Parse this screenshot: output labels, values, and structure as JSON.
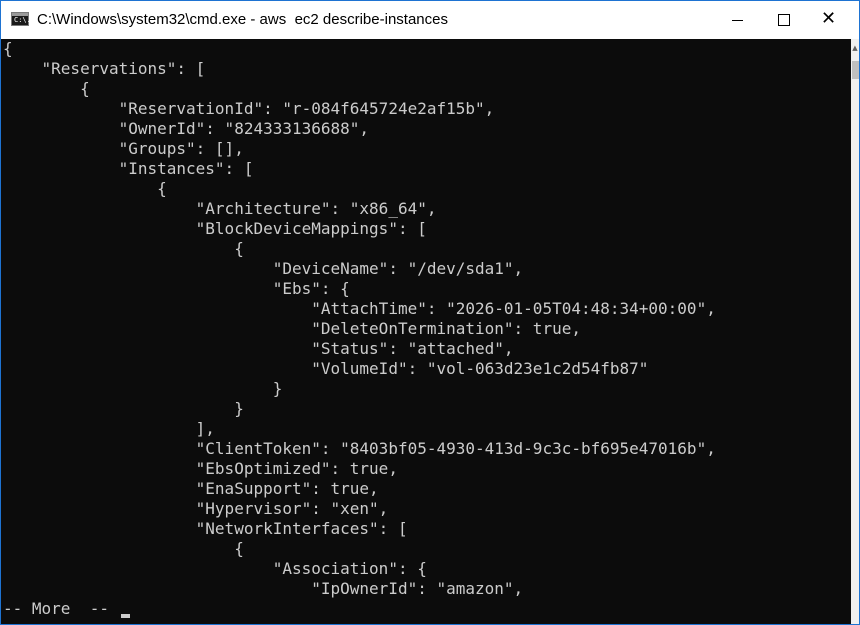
{
  "window": {
    "title": "C:\\Windows\\system32\\cmd.exe - aws  ec2 describe-instances",
    "icon": "cmd-icon",
    "icon_glyph": "C:\\."
  },
  "controls": {
    "minimize_icon": "minimize-icon",
    "maximize_icon": "maximize-icon",
    "close_icon": "close-icon",
    "close_glyph": "✕"
  },
  "console": {
    "lines": [
      "{",
      "    \"Reservations\": [",
      "        {",
      "            \"ReservationId\": \"r-084f645724e2af15b\",",
      "            \"OwnerId\": \"824333136688\",",
      "            \"Groups\": [],",
      "            \"Instances\": [",
      "                {",
      "                    \"Architecture\": \"x86_64\",",
      "                    \"BlockDeviceMappings\": [",
      "                        {",
      "                            \"DeviceName\": \"/dev/sda1\",",
      "                            \"Ebs\": {",
      "                                \"AttachTime\": \"2026-01-05T04:48:34+00:00\",",
      "                                \"DeleteOnTermination\": true,",
      "                                \"Status\": \"attached\",",
      "                                \"VolumeId\": \"vol-063d23e1c2d54fb87\"",
      "                            }",
      "                        }",
      "                    ],",
      "                    \"ClientToken\": \"8403bf05-4930-413d-9c3c-bf695e47016b\",",
      "                    \"EbsOptimized\": true,",
      "                    \"EnaSupport\": true,",
      "                    \"Hypervisor\": \"xen\",",
      "                    \"NetworkInterfaces\": [",
      "                        {",
      "                            \"Association\": {",
      "                                \"IpOwnerId\": \"amazon\","
    ],
    "more_prompt": "-- More  --"
  }
}
